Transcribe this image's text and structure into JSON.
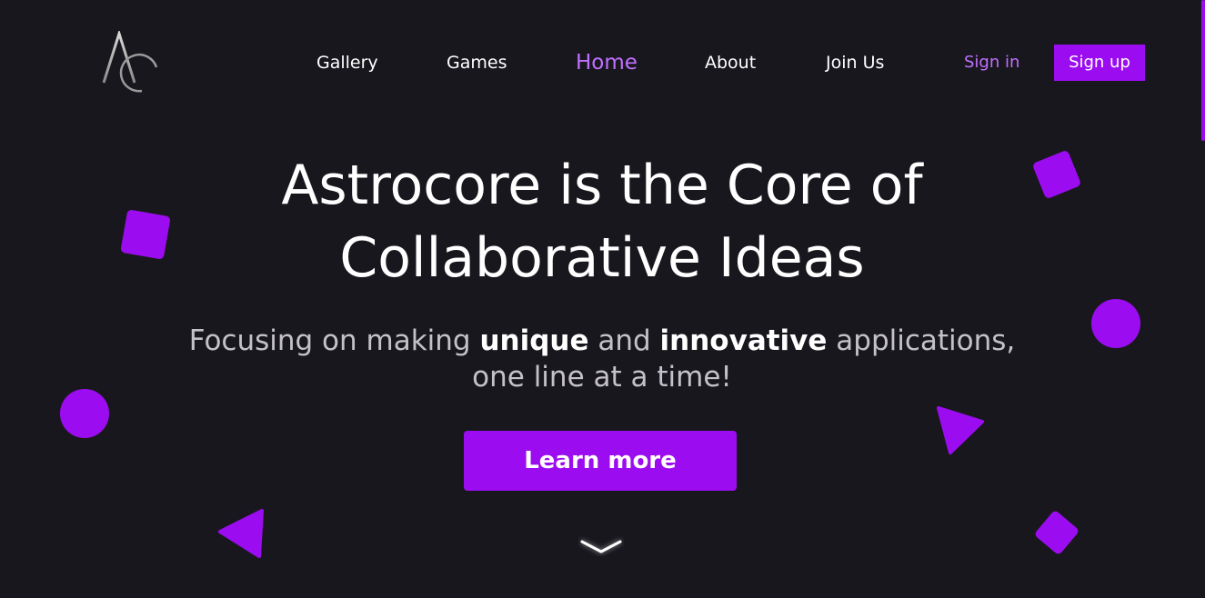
{
  "brand": {
    "logo_icon": "ac-monogram-logo-icon"
  },
  "nav": {
    "items": [
      {
        "label": "Gallery"
      },
      {
        "label": "Games"
      },
      {
        "label": "Home",
        "active": true
      },
      {
        "label": "About"
      },
      {
        "label": "Join Us"
      }
    ],
    "signin_label": "Sign in",
    "signup_label": "Sign up"
  },
  "hero": {
    "title_line1": "Astrocore is the Core of",
    "title_line2": "Collaborative Ideas",
    "subtitle": {
      "part1": "Focusing on making ",
      "bold1": "unique",
      "part2": " and ",
      "bold2": "innovative",
      "part3": " applications,",
      "line2": "one line at a time!"
    },
    "cta_label": "Learn more",
    "scroll_icon": "chevron-down-icon"
  },
  "theme": {
    "background": "#19171e",
    "accent": "#9b0df0",
    "accent_text": "#c070ff",
    "muted_text": "#c4c2c8"
  }
}
